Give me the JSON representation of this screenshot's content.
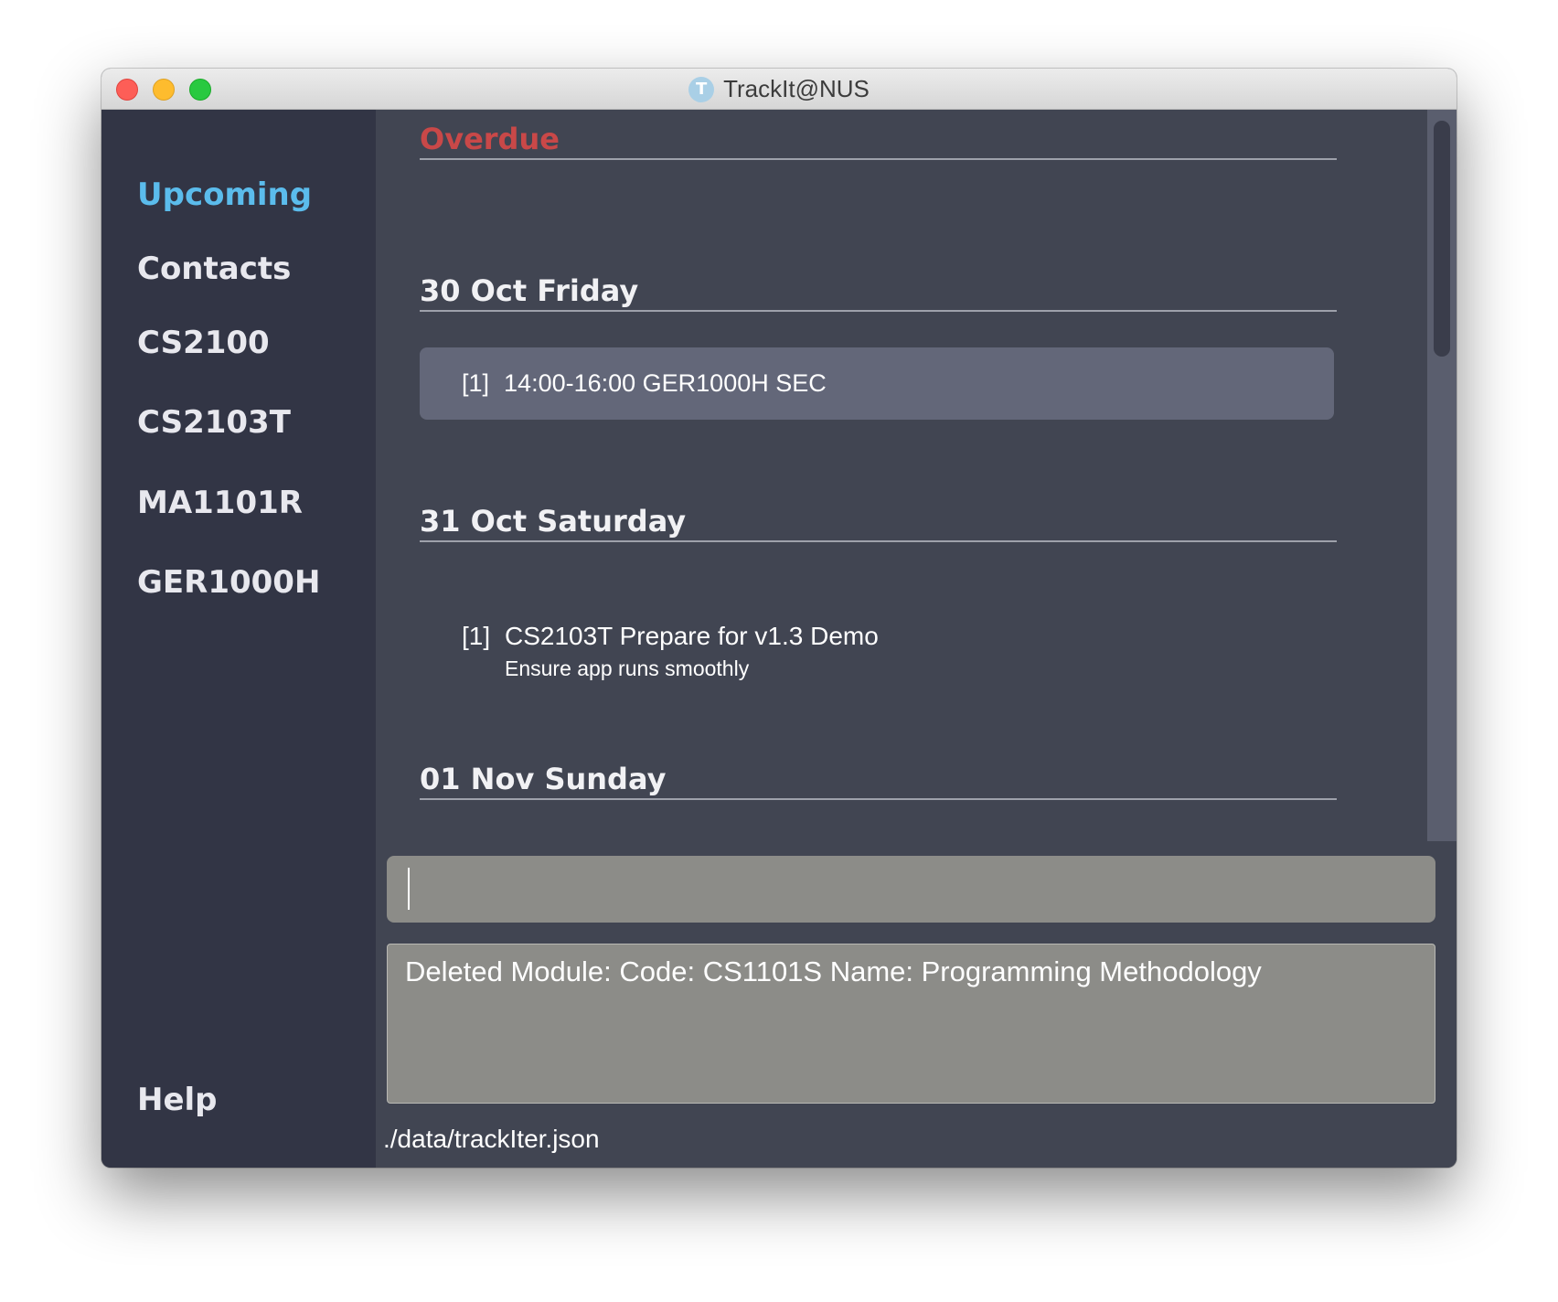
{
  "window": {
    "title": "TrackIt@NUS",
    "app_icon_letter": "T"
  },
  "sidebar": {
    "items": [
      {
        "label": "Upcoming",
        "active": true
      },
      {
        "label": "Contacts",
        "active": false
      },
      {
        "label": "CS2100",
        "active": false
      },
      {
        "label": "CS2103T",
        "active": false
      },
      {
        "label": "MA1101R",
        "active": false
      },
      {
        "label": "GER1000H",
        "active": false
      }
    ],
    "help_label": "Help"
  },
  "upcoming": {
    "overdue_header": "Overdue",
    "days": [
      {
        "header": "30 Oct Friday",
        "events": [
          {
            "index": "[1]",
            "text": "14:00-16:00  GER1000H  SEC"
          }
        ]
      },
      {
        "header": "31 Oct Saturday",
        "tasks": [
          {
            "index": "[1]",
            "title": "CS2103T Prepare for v1.3 Demo",
            "description": "Ensure app runs smoothly"
          }
        ]
      },
      {
        "header": "01 Nov Sunday"
      }
    ]
  },
  "command_box": {
    "value": ""
  },
  "result_display": {
    "text": "Deleted Module:  Code: CS1101S Name: Programming Methodology"
  },
  "status_bar": {
    "file_path": "./data/trackIter.json"
  },
  "colors": {
    "active_nav": "#5bbcec",
    "overdue": "#c94848",
    "sidebar_bg": "#323545",
    "main_bg": "#414552",
    "event_card_bg": "#636779",
    "input_bg": "#8c8c88"
  }
}
